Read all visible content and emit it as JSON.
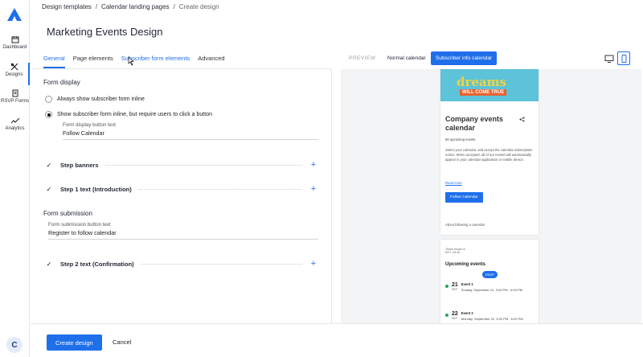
{
  "nav": {
    "items": [
      {
        "label": "Dashboard",
        "icon": "calendar-icon"
      },
      {
        "label": "Designs",
        "icon": "designs-icon",
        "active": true
      },
      {
        "label": "RSVP Forms",
        "icon": "form-icon"
      },
      {
        "label": "Analytics",
        "icon": "analytics-icon"
      }
    ],
    "avatar_initial": "C"
  },
  "breadcrumb": {
    "items": [
      "Design templates",
      "Calendar landing pages",
      "Create design"
    ],
    "separator": "/"
  },
  "page_title": "Marketing Events Design",
  "tabs": [
    {
      "label": "General",
      "active": true
    },
    {
      "label": "Page elements"
    },
    {
      "label": "Subscriber form elements",
      "hover": true
    },
    {
      "label": "Advanced"
    }
  ],
  "form_display": {
    "title": "Form display",
    "option1": "Always show subscriber form inline",
    "option2": "Show subscriber form inline, but require users to click a button",
    "button_text_label": "Form display button text",
    "button_text_value": "Follow Calendar"
  },
  "steps": {
    "banners": "Step banners",
    "step1": "Step 1 text (Introduction)",
    "step2": "Step 2 text (Confirmation)",
    "check": "✓",
    "plus": "+"
  },
  "form_submission": {
    "title": "Form submission",
    "label": "Form submission button text",
    "value": "Register to follow calendar"
  },
  "preview": {
    "label": "PREVIEW",
    "normal_btn": "Normal calendar",
    "subscriber_btn": "Subscriber info calendar",
    "banner_word": "dreams",
    "banner_tag": "WILL COME TRUE",
    "cal_title": "Company events calendar",
    "upcoming_count": "50 upcoming events",
    "desc": "Select your calendar, and accept the calendar subscription notice. When accepted, all of our events will automatically appear in your calendar application or mobile device.",
    "read_more": "Read more",
    "follow_btn": "Follow Calendar",
    "about": "About following a calendar",
    "tz_label": "Times shown in",
    "tz_value": "EDT -04:00",
    "upcoming_title": "Upcoming events",
    "rsvp": "RSVP",
    "events": [
      {
        "day": "21",
        "mon": "SEP",
        "name": "Event 1",
        "date": "Sunday, September 21, 3:00 PM - 6:00 PM"
      },
      {
        "day": "22",
        "mon": "SEP",
        "name": "Event 2",
        "date": "Monday, September 22, 3:00 PM - 6:00 PM"
      }
    ]
  },
  "footer": {
    "create": "Create design",
    "cancel": "Cancel"
  },
  "colors": {
    "accent": "#1f6feb",
    "banner_bg": "#5cc3d8",
    "banner_word": "#f4d33c",
    "banner_tag_bg": "#e9622f",
    "event_dot": "#2fa35a"
  }
}
